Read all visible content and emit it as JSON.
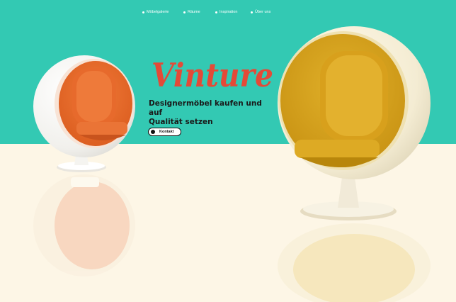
{
  "nav": {
    "items": [
      {
        "label": "Möbelgalerie"
      },
      {
        "label": "Räume"
      },
      {
        "label": "Inspiration"
      },
      {
        "label": "Über uns"
      }
    ]
  },
  "hero": {
    "brand": "Vinture",
    "tagline_line1": "Designermöbel kaufen und auf",
    "tagline_line2": "Qualität setzen",
    "cta_label": "Kontakt"
  },
  "colors": {
    "sky": "#33c9b3",
    "floor": "#fdf6e6",
    "brand": "#e44a37",
    "chair_left_inner": "#e8662a",
    "chair_right_inner": "#d9a319",
    "shell": "#f2ede0"
  }
}
